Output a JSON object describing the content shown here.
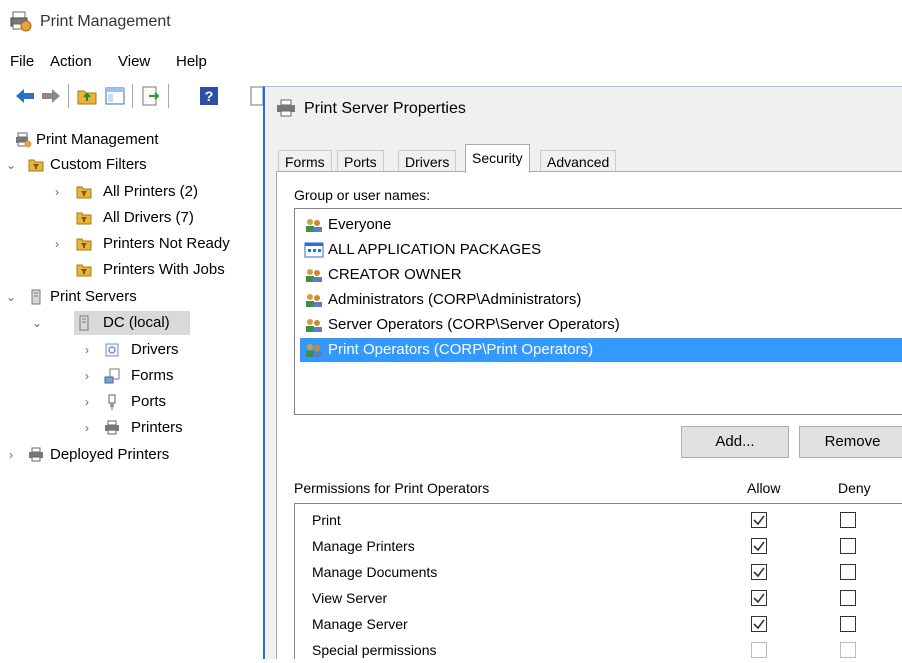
{
  "window": {
    "title": "Print Management"
  },
  "menu": [
    "File",
    "Action",
    "View",
    "Help"
  ],
  "toolbar_icons": [
    "back-arrow-icon",
    "forward-arrow-icon",
    "folder-up-icon",
    "show-hide-tree-icon",
    "export-list-icon",
    "help-icon",
    "properties-icon"
  ],
  "tree": {
    "root": "Print Management",
    "custom_filters": "Custom Filters",
    "all_printers": "All Printers (2)",
    "all_drivers": "All Drivers (7)",
    "printers_not_ready": "Printers Not Ready",
    "printers_with_jobs": "Printers With Jobs",
    "print_servers": "Print Servers",
    "dc_local": "DC (local)",
    "drivers": "Drivers",
    "forms": "Forms",
    "ports": "Ports",
    "printers": "Printers",
    "deployed_printers": "Deployed Printers"
  },
  "dialog": {
    "title": "Print Server Properties",
    "tabs": [
      "Forms",
      "Ports",
      "Drivers",
      "Security",
      "Advanced"
    ],
    "active_tab": "Security",
    "group_label": "Group or user names:",
    "users": [
      {
        "name": "Everyone",
        "icon": "user-group-icon"
      },
      {
        "name": "ALL APPLICATION PACKAGES",
        "icon": "app-packages-icon"
      },
      {
        "name": "CREATOR OWNER",
        "icon": "user-group-icon"
      },
      {
        "name": "Administrators (CORP\\Administrators)",
        "icon": "user-group-icon"
      },
      {
        "name": "Server Operators (CORP\\Server Operators)",
        "icon": "user-group-icon"
      },
      {
        "name": "Print Operators (CORP\\Print Operators)",
        "icon": "user-group-icon",
        "selected": true
      }
    ],
    "add_button": "Add...",
    "remove_button": "Remove",
    "permissions_label": "Permissions for Print Operators",
    "allow_header": "Allow",
    "deny_header": "Deny",
    "permissions": [
      {
        "name": "Print",
        "allow": true,
        "deny": false
      },
      {
        "name": "Manage Printers",
        "allow": true,
        "deny": false
      },
      {
        "name": "Manage Documents",
        "allow": true,
        "deny": false
      },
      {
        "name": "View Server",
        "allow": true,
        "deny": false
      },
      {
        "name": "Manage Server",
        "allow": true,
        "deny": false
      },
      {
        "name": "Special permissions",
        "allow": false,
        "deny": false,
        "disabled": true
      }
    ]
  },
  "colors": {
    "selection": "#3399ff",
    "accent": "#1e6fd8",
    "folder": "#e8b53a"
  }
}
